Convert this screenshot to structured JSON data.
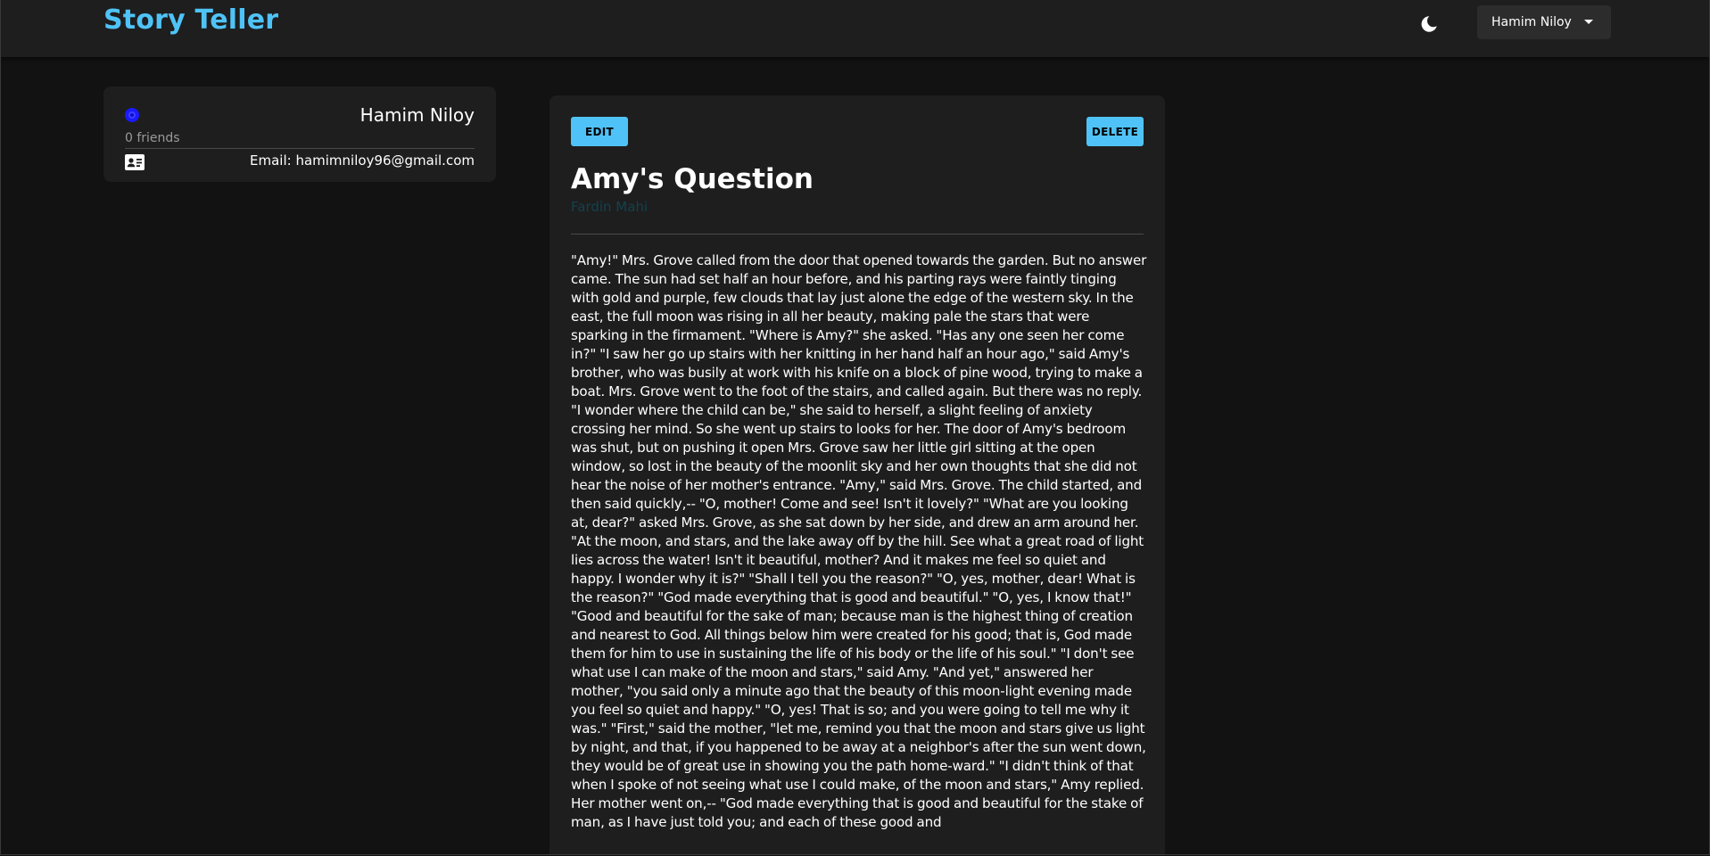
{
  "header": {
    "brand": "Story Teller",
    "theme_icon": "moon-icon",
    "user_menu_label": "Hamim Niloy",
    "user_menu_icon": "caret-down-icon"
  },
  "profile": {
    "name": "Hamim Niloy",
    "friends": "0 friends",
    "email": "Email: hamimniloy96@gmail.com",
    "avatar_color": "#1a1aff",
    "contact_icon": "contact-card-icon"
  },
  "story": {
    "edit_label": "EDIT",
    "delete_label": "DELETE",
    "title": "Amy's Question",
    "author": "Fardin Mahi",
    "body": "\"Amy!\" Mrs. Grove called from the door that opened towards the garden. But no answer came. The sun had set half an hour before, and his parting rays were faintly tinging with gold and purple, few clouds that lay just alone the edge of the western sky. In the east, the full moon was rising in all her beauty, making pale the stars that were sparking in the firmament. \"Where is Amy?\" she asked. \"Has any one seen her come in?\" \"I saw her go up stairs with her knitting in her hand half an hour ago,\" said Amy's brother, who was busily at work with his knife on a block of pine wood, trying to make a boat. Mrs. Grove went to the foot of the stairs, and called again. But there was no reply. \"I wonder where the child can be,\" she said to herself, a slight feeling of anxiety crossing her mind. So she went up stairs to looks for her. The door of Amy's bedroom was shut, but on pushing it open Mrs. Grove saw her little girl sitting at the open window, so lost in the beauty of the moonlit sky and her own thoughts that she did not hear the noise of her mother's entrance. \"Amy,\" said Mrs. Grove. The child started, and then said quickly,-- \"O, mother! Come and see! Isn't it lovely?\" \"What are you looking at, dear?\" asked Mrs. Grove, as she sat down by her side, and drew an arm around her. \"At the moon, and stars, and the lake away off by the hill. See what a great road of light lies across the water! Isn't it beautiful, mother? And it makes me feel so quiet and happy. I wonder why it is?\" \"Shall I tell you the reason?\" \"O, yes, mother, dear! What is the reason?\" \"God made everything that is good and beautiful.\" \"O, yes, I know that!\" \"Good and beautiful for the sake of man; because man is the highest thing of creation and nearest to God. All things below him were created for his good; that is, God made them for him to use in sustaining the life of his body or the life of his soul.\" \"I don't see what use I can make of the moon and stars,\" said Amy. \"And yet,\" answered her mother, \"you said only a minute ago that the beauty of this moon-light evening made you feel so quiet and happy.\" \"O, yes! That is so; and you were going to tell me why it was.\" \"First,\" said the mother, \"let me, remind you that the moon and stars give us light by night, and that, if you happened to be away at a neighbor's after the sun went down, they would be of great use in showing you the path home-ward.\" \"I didn't think of that when I spoke of not seeing what use I could make, of the moon and stars,\" Amy replied. Her mother went on,-- \"God made everything that is good and beautiful for the stake of man, as I have just told you; and each of these good and"
  }
}
